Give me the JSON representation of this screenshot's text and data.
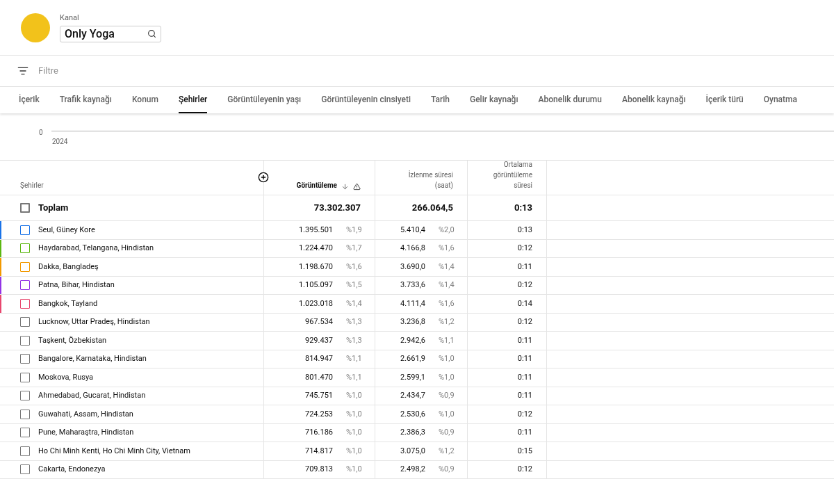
{
  "channel": {
    "label": "Kanal",
    "value": "Only Yoga"
  },
  "filter": {
    "placeholder": "Filtre"
  },
  "tabs": [
    {
      "label": "İçerik",
      "selected": false
    },
    {
      "label": "Trafik kaynağı",
      "selected": false
    },
    {
      "label": "Konum",
      "selected": false
    },
    {
      "label": "Şehirler",
      "selected": true
    },
    {
      "label": "Görüntüleyenin yaşı",
      "selected": false
    },
    {
      "label": "Görüntüleyenin cinsiyeti",
      "selected": false
    },
    {
      "label": "Tarih",
      "selected": false
    },
    {
      "label": "Gelir kaynağı",
      "selected": false
    },
    {
      "label": "Abonelik durumu",
      "selected": false
    },
    {
      "label": "Abonelik kaynağı",
      "selected": false
    },
    {
      "label": "İçerik türü",
      "selected": false
    },
    {
      "label": "Oynatma",
      "selected": false
    }
  ],
  "chart": {
    "y_label": "0",
    "x_label": "2024"
  },
  "table": {
    "columns": [
      "Şehirler",
      "Görüntüleme",
      "İzlenme süresi (saat)",
      "Ortalama görüntüleme süresi"
    ],
    "total": {
      "label": "Toplam",
      "views": "73.302.307",
      "watch": "266.064,5",
      "avg": "0:13",
      "checked": false
    },
    "rows": [
      {
        "city": "Seul, Güney Kore",
        "views": "1.395.501",
        "views_pct": "%1,9",
        "watch": "5.410,4",
        "watch_pct": "%2,0",
        "avg": "0:13",
        "color": "#1a73e8",
        "checked": false
      },
      {
        "city": "Haydarabad, Telangana, Hindistan",
        "views": "1.224.470",
        "views_pct": "%1,7",
        "watch": "4.166,8",
        "watch_pct": "%1,6",
        "avg": "0:12",
        "color": "#5bb711",
        "checked": false
      },
      {
        "city": "Dakka, Bangladeş",
        "views": "1.198.670",
        "views_pct": "%1,6",
        "watch": "3.690,0",
        "watch_pct": "%1,4",
        "avg": "0:11",
        "color": "#f29900",
        "checked": false
      },
      {
        "city": "Patna, Bihar, Hindistan",
        "views": "1.105.097",
        "views_pct": "%1,5",
        "watch": "3.733,6",
        "watch_pct": "%1,4",
        "avg": "0:12",
        "color": "#9334e6",
        "checked": false
      },
      {
        "city": "Bangkok, Tayland",
        "views": "1.023.018",
        "views_pct": "%1,4",
        "watch": "4.111,4",
        "watch_pct": "%1,6",
        "avg": "0:14",
        "color": "#e8466e",
        "checked": false
      },
      {
        "city": "Lucknow, Uttar Pradeş, Hindistan",
        "views": "967.534",
        "views_pct": "%1,3",
        "watch": "3.236,8",
        "watch_pct": "%1,2",
        "avg": "0:12",
        "checked": false
      },
      {
        "city": "Taşkent, Özbekistan",
        "views": "929.437",
        "views_pct": "%1,3",
        "watch": "2.942,6",
        "watch_pct": "%1,1",
        "avg": "0:11",
        "checked": false
      },
      {
        "city": "Bangalore, Karnataka, Hindistan",
        "views": "814.947",
        "views_pct": "%1,1",
        "watch": "2.661,9",
        "watch_pct": "%1,0",
        "avg": "0:11",
        "checked": false
      },
      {
        "city": "Moskova, Rusya",
        "views": "801.470",
        "views_pct": "%1,1",
        "watch": "2.599,1",
        "watch_pct": "%1,0",
        "avg": "0:11",
        "checked": false
      },
      {
        "city": "Ahmedabad, Gucarat, Hindistan",
        "views": "745.751",
        "views_pct": "%1,0",
        "watch": "2.434,7",
        "watch_pct": "%0,9",
        "avg": "0:11",
        "checked": false
      },
      {
        "city": "Guwahati, Assam, Hindistan",
        "views": "724.253",
        "views_pct": "%1,0",
        "watch": "2.530,6",
        "watch_pct": "%1,0",
        "avg": "0:12",
        "checked": false
      },
      {
        "city": "Pune, Maharaştra, Hindistan",
        "views": "716.186",
        "views_pct": "%1,0",
        "watch": "2.386,3",
        "watch_pct": "%0,9",
        "avg": "0:11",
        "checked": false
      },
      {
        "city": "Ho Chi Minh Kenti, Ho Chi Minh City, Vietnam",
        "views": "714.817",
        "views_pct": "%1,0",
        "watch": "3.075,0",
        "watch_pct": "%1,2",
        "avg": "0:15",
        "checked": false
      },
      {
        "city": "Cakarta, Endonezya",
        "views": "709.813",
        "views_pct": "%1,0",
        "watch": "2.498,2",
        "watch_pct": "%0,9",
        "avg": "0:12",
        "checked": false
      }
    ]
  }
}
